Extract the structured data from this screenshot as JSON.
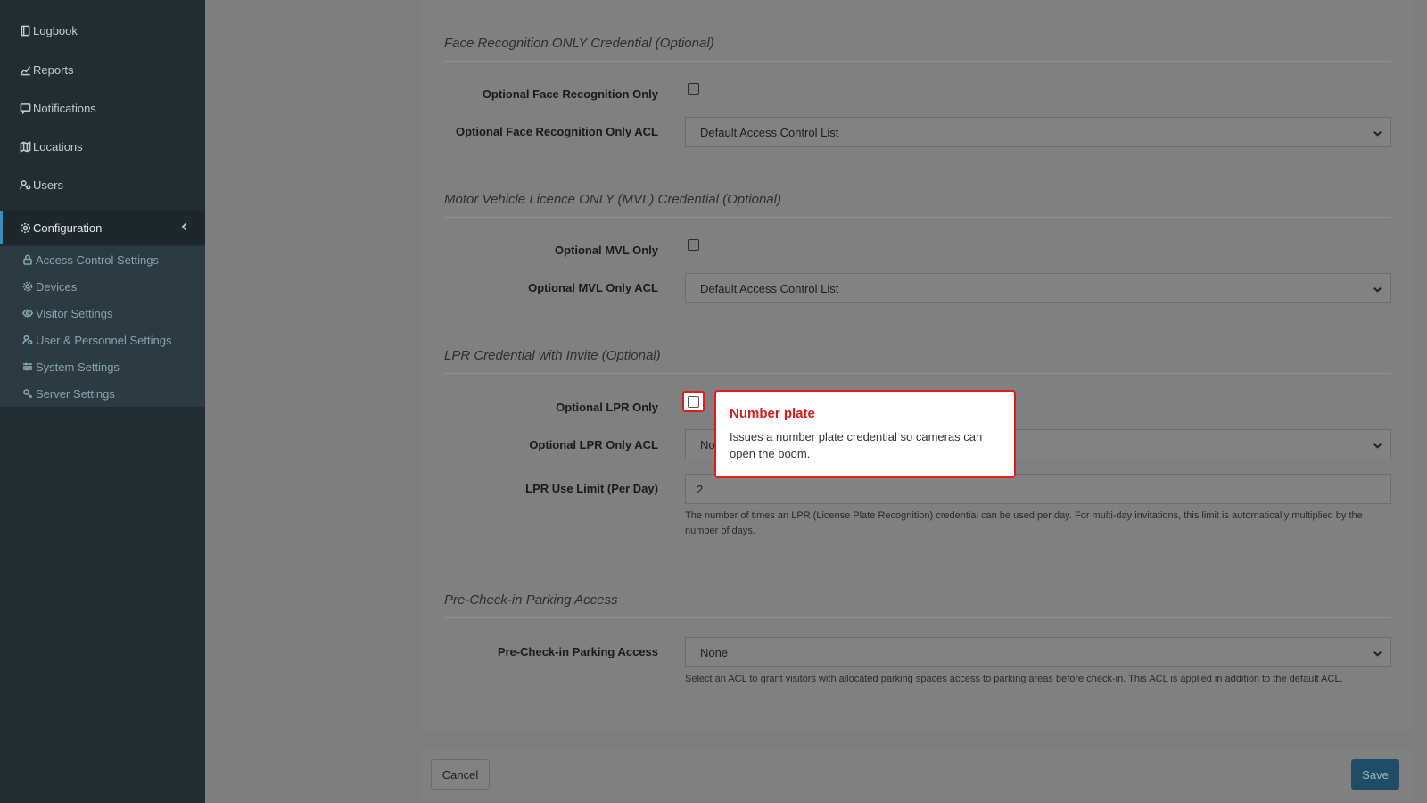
{
  "sidebar": {
    "items": [
      {
        "label": "Logbook",
        "icon": "book-icon"
      },
      {
        "label": "Reports",
        "icon": "chart-icon"
      },
      {
        "label": "Notifications",
        "icon": "message-icon"
      },
      {
        "label": "Locations",
        "icon": "map-icon"
      },
      {
        "label": "Users",
        "icon": "users-icon"
      },
      {
        "label": "Configuration",
        "icon": "gear-icon"
      }
    ],
    "subitems": [
      {
        "label": "Access Control Settings",
        "icon": "lock-icon"
      },
      {
        "label": "Devices",
        "icon": "device-icon"
      },
      {
        "label": "Visitor Settings",
        "icon": "eye-icon"
      },
      {
        "label": "User & Personnel Settings",
        "icon": "user-settings-icon"
      },
      {
        "label": "System Settings",
        "icon": "sliders-icon"
      },
      {
        "label": "Server Settings",
        "icon": "server-icon"
      }
    ]
  },
  "sections": {
    "face": {
      "title": "Face Recognition ONLY Credential (Optional)",
      "checkbox_label": "Optional Face Recognition Only",
      "acl_label": "Optional Face Recognition Only ACL",
      "acl_value": "Default Access Control List"
    },
    "mvl": {
      "title": "Motor Vehicle Licence ONLY (MVL) Credential (Optional)",
      "checkbox_label": "Optional MVL Only",
      "acl_label": "Optional MVL Only ACL",
      "acl_value": "Default Access Control List"
    },
    "lpr": {
      "title": "LPR Credential with Invite (Optional)",
      "checkbox_label": "Optional LPR Only",
      "acl_label": "Optional LPR Only ACL",
      "acl_value": "No",
      "limit_label": "LPR Use Limit (Per Day)",
      "limit_value": "2",
      "limit_help": "The number of times an LPR (License Plate Recognition) credential can be used per day. For multi-day invitations, this limit is automatically multiplied by the number of days."
    },
    "parking": {
      "title": "Pre-Check-in Parking Access",
      "label": "Pre-Check-in Parking Access",
      "value": "None",
      "help": "Select an ACL to grant visitors with allocated parking spaces access to parking areas before check-in. This ACL is applied in addition to the default ACL."
    }
  },
  "footer": {
    "cancel_label": "Cancel",
    "save_label": "Save"
  },
  "tooltip": {
    "title": "Number plate",
    "body": "Issues a number plate credential so cameras can open the boom."
  },
  "colors": {
    "accent": "#3c8dbc",
    "highlight": "#e41b1b"
  }
}
